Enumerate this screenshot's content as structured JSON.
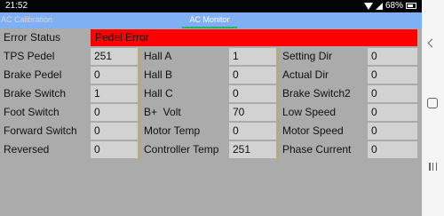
{
  "status_bar": {
    "time": "21:52",
    "battery": "68%"
  },
  "tabs": [
    {
      "label": "AC Calibration",
      "active": false
    },
    {
      "label": "AC Monitor",
      "active": true
    }
  ],
  "error_status": {
    "label": "Error Status",
    "value": "Pedel Error"
  },
  "rows": [
    {
      "c1": {
        "label": "TPS Pedel",
        "value": "251"
      },
      "c2": {
        "label": "Hall A",
        "value": "1"
      },
      "c3": {
        "label": "Setting Dir",
        "value": "0"
      }
    },
    {
      "c1": {
        "label": "Brake Pedel",
        "value": "0"
      },
      "c2": {
        "label": "Hall B",
        "value": "0"
      },
      "c3": {
        "label": "Actual Dir",
        "value": "0"
      }
    },
    {
      "c1": {
        "label": "Brake Switch",
        "value": "1"
      },
      "c2": {
        "label": "Hall C",
        "value": "0"
      },
      "c3": {
        "label": "Brake Switch2",
        "value": "0"
      }
    },
    {
      "c1": {
        "label": "Foot Switch",
        "value": "0"
      },
      "c2": {
        "label": "B+  Volt",
        "value": "70"
      },
      "c3": {
        "label": "Low Speed",
        "value": "0"
      }
    },
    {
      "c1": {
        "label": "Forward Switch",
        "value": "0"
      },
      "c2": {
        "label": "Motor Temp",
        "value": "0"
      },
      "c3": {
        "label": "Motor Speed",
        "value": "0"
      }
    },
    {
      "c1": {
        "label": "Reversed",
        "value": "0"
      },
      "c2": {
        "label": "Controller Temp",
        "value": "251"
      },
      "c3": {
        "label": "Phase Current",
        "value": "0"
      }
    }
  ],
  "colors": {
    "background": "#ababab",
    "tab_bar": "#7fb0f3",
    "error": "#ff0000",
    "value_cell": "#d2d2d2",
    "tab_indicator": "#1fb56a"
  },
  "icons": [
    "wifi-icon",
    "signal-icon",
    "battery-icon",
    "back-icon",
    "home-icon",
    "recents-icon"
  ]
}
